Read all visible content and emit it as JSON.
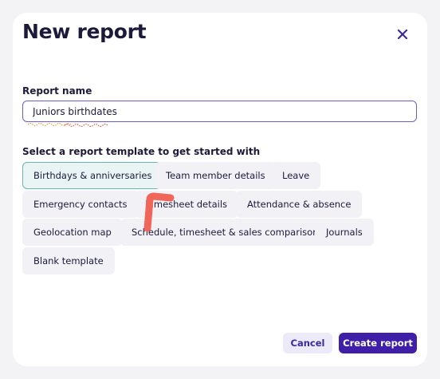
{
  "modal": {
    "title": "New report",
    "close_icon": "close-icon"
  },
  "form": {
    "report_name_label": "Report name",
    "report_name_value": "Juniors birthdates",
    "template_section_label": "Select a report template to get started with"
  },
  "templates": [
    {
      "label": "Birthdays & anniversaries",
      "selected": true
    },
    {
      "label": "Team member details",
      "selected": false
    },
    {
      "label": "Leave",
      "selected": false
    },
    {
      "label": "Emergency contacts",
      "selected": false
    },
    {
      "label": "Timesheet details",
      "selected": false
    },
    {
      "label": "Attendance & absence",
      "selected": false
    },
    {
      "label": "Geolocation map",
      "selected": false
    },
    {
      "label": "Schedule, timesheet & sales comparison",
      "selected": false
    },
    {
      "label": "Journals",
      "selected": false
    },
    {
      "label": "Blank template",
      "selected": false
    }
  ],
  "footer": {
    "cancel_label": "Cancel",
    "create_label": "Create report"
  },
  "colors": {
    "primary": "#3f1fa8",
    "selected_border": "#6fb6b0",
    "spellcheck": "#e8574a"
  }
}
